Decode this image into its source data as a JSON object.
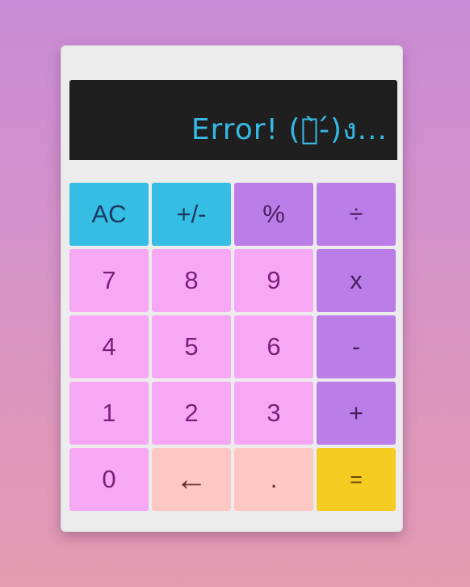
{
  "display": {
    "text": "Error! (ง̀-́)ง..."
  },
  "keys": {
    "ac": "AC",
    "sign": "+/-",
    "percent": "%",
    "divide": "÷",
    "seven": "7",
    "eight": "8",
    "nine": "9",
    "multiply": "x",
    "four": "4",
    "five": "5",
    "six": "6",
    "subtract": "-",
    "one": "1",
    "two": "2",
    "three": "3",
    "add": "+",
    "zero": "0",
    "backspace": "←",
    "decimal": ".",
    "equals": "="
  },
  "colors": {
    "utility": "#36bde3",
    "operator": "#bb7ee8",
    "number": "#f7a8f4",
    "backspace": "#fdc7c3",
    "equals": "#f4cc22",
    "display_bg": "#1f1f1f",
    "display_text": "#37b8e4"
  }
}
